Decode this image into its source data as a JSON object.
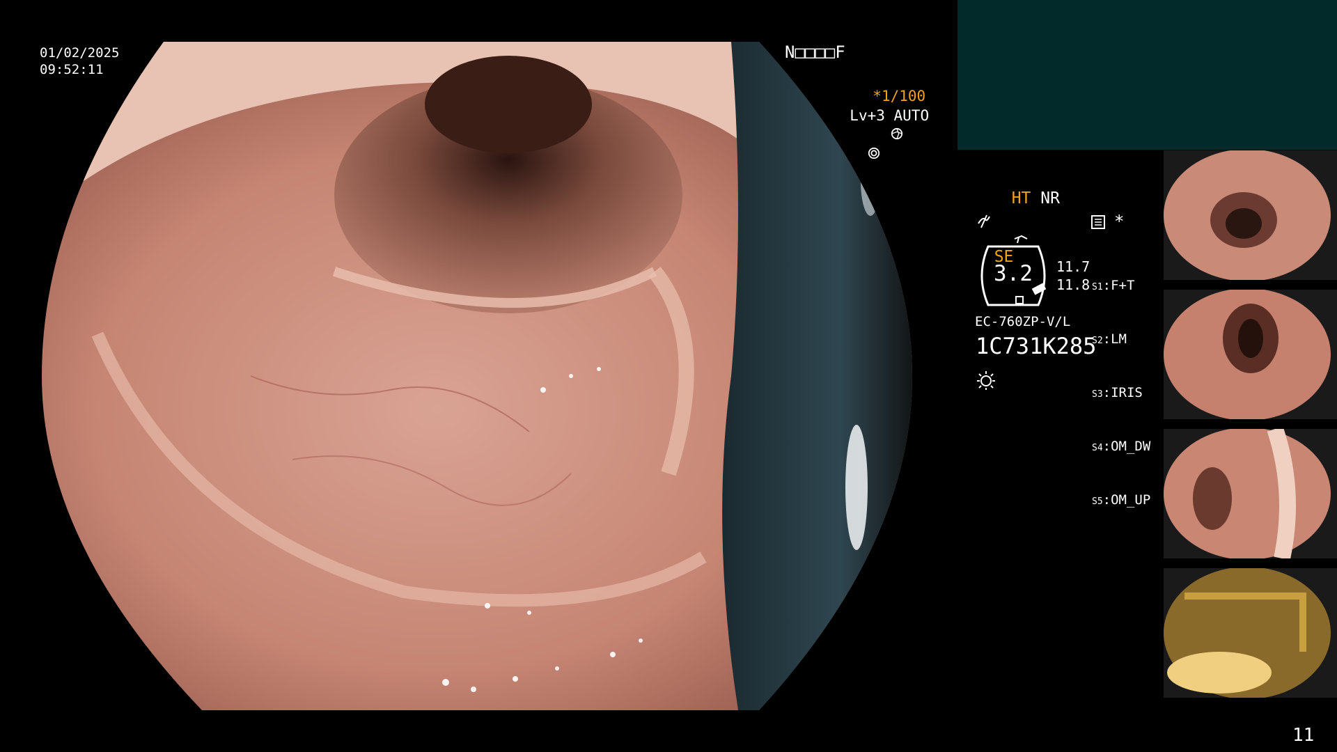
{
  "osd": {
    "date": "01/02/2025",
    "time": "09:52:11",
    "patient_field": "N□□□□F",
    "shutter": "*1/100",
    "shutter_icon": "shutter-icon",
    "level": "Lv+3 AUTO",
    "auto_icon": "iris-icon",
    "ht": "HT",
    "nr": "NR",
    "se": "SE",
    "se_icon": "scope-mode-icon",
    "freeze_icon": "freeze-icon",
    "record_icon": "record-icon",
    "star": "*",
    "gauge_value": "3.2",
    "gauge_top": "11.7",
    "gauge_bottom": "11.8",
    "scope_model": "EC-760ZP-V/L",
    "serial": "1C731K285",
    "light_icon": "light-icon",
    "switches": [
      {
        "key": "S1",
        "value": "F+T"
      },
      {
        "key": "S2",
        "value": "LM"
      },
      {
        "key": "S3",
        "value": "IRIS"
      },
      {
        "key": "S4",
        "value": "OM_DW"
      },
      {
        "key": "S5",
        "value": "OM_UP"
      }
    ],
    "page_number": "11"
  },
  "colors": {
    "amber": "#f4a21a",
    "panel": "#032a2a",
    "mucosa": "#c98a78"
  }
}
